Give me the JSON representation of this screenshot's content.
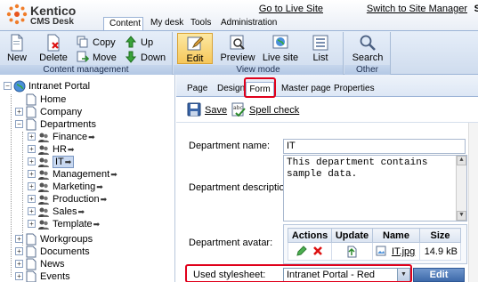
{
  "header": {
    "logo_name": "Kentico",
    "logo_product": "CMS Desk",
    "links": [
      "Go to Live Site",
      "Switch to Site Manager",
      "S"
    ],
    "tabs": [
      "Content",
      "My desk",
      "Tools",
      "Administration"
    ],
    "active_tab": "Content"
  },
  "ribbon": {
    "groups": [
      {
        "label": "Content management",
        "big": [
          {
            "label": "New",
            "icon": "new-document-icon"
          },
          {
            "label": "Delete",
            "icon": "delete-document-icon"
          }
        ],
        "small": [
          {
            "label": "Copy",
            "icon": "copy-icon"
          },
          {
            "label": "Move",
            "icon": "move-icon"
          },
          {
            "label": "Up",
            "icon": "arrow-up-icon"
          },
          {
            "label": "Down",
            "icon": "arrow-down-icon"
          }
        ]
      },
      {
        "label": "View mode",
        "big": [
          {
            "label": "Edit",
            "icon": "edit-icon"
          },
          {
            "label": "Preview",
            "icon": "preview-icon"
          },
          {
            "label": "Live site",
            "icon": "globe-icon"
          },
          {
            "label": "List",
            "icon": "list-icon"
          }
        ],
        "selected": "Edit"
      },
      {
        "label": "Other",
        "big": [
          {
            "label": "Search",
            "icon": "search-icon"
          }
        ]
      }
    ]
  },
  "tree": {
    "root": "Intranet Portal",
    "nodes": [
      "Home",
      "Company",
      "Departments",
      "Finance",
      "HR",
      "IT",
      "Management",
      "Marketing",
      "Production",
      "Sales",
      "Template",
      "Workgroups",
      "Documents",
      "News",
      "Events"
    ],
    "selected": "IT"
  },
  "subtabs": {
    "items": [
      "Page",
      "Design",
      "Form",
      "Master page",
      "Properties"
    ],
    "active": "Form"
  },
  "actions": {
    "save": "Save",
    "spell_check": "Spell check"
  },
  "form": {
    "dept_name_label": "Department name:",
    "dept_name_value": "IT",
    "dept_desc_label": "Department description:",
    "dept_desc_value": "This department contains sample data.",
    "dept_avatar_label": "Department avatar:",
    "avatar_table": {
      "headers": [
        "Actions",
        "Update",
        "Name",
        "Size"
      ],
      "row": {
        "name": "IT.jpg",
        "size": "14.9 kB"
      }
    },
    "stylesheet_label": "Used stylesheet:",
    "stylesheet_value": "Intranet Portal - Red",
    "edit_button": "Edit"
  },
  "colors": {
    "highlight": "#e0001b",
    "ribbon_selected": "#f6c75a",
    "edit_button": "#3e6aaa"
  }
}
